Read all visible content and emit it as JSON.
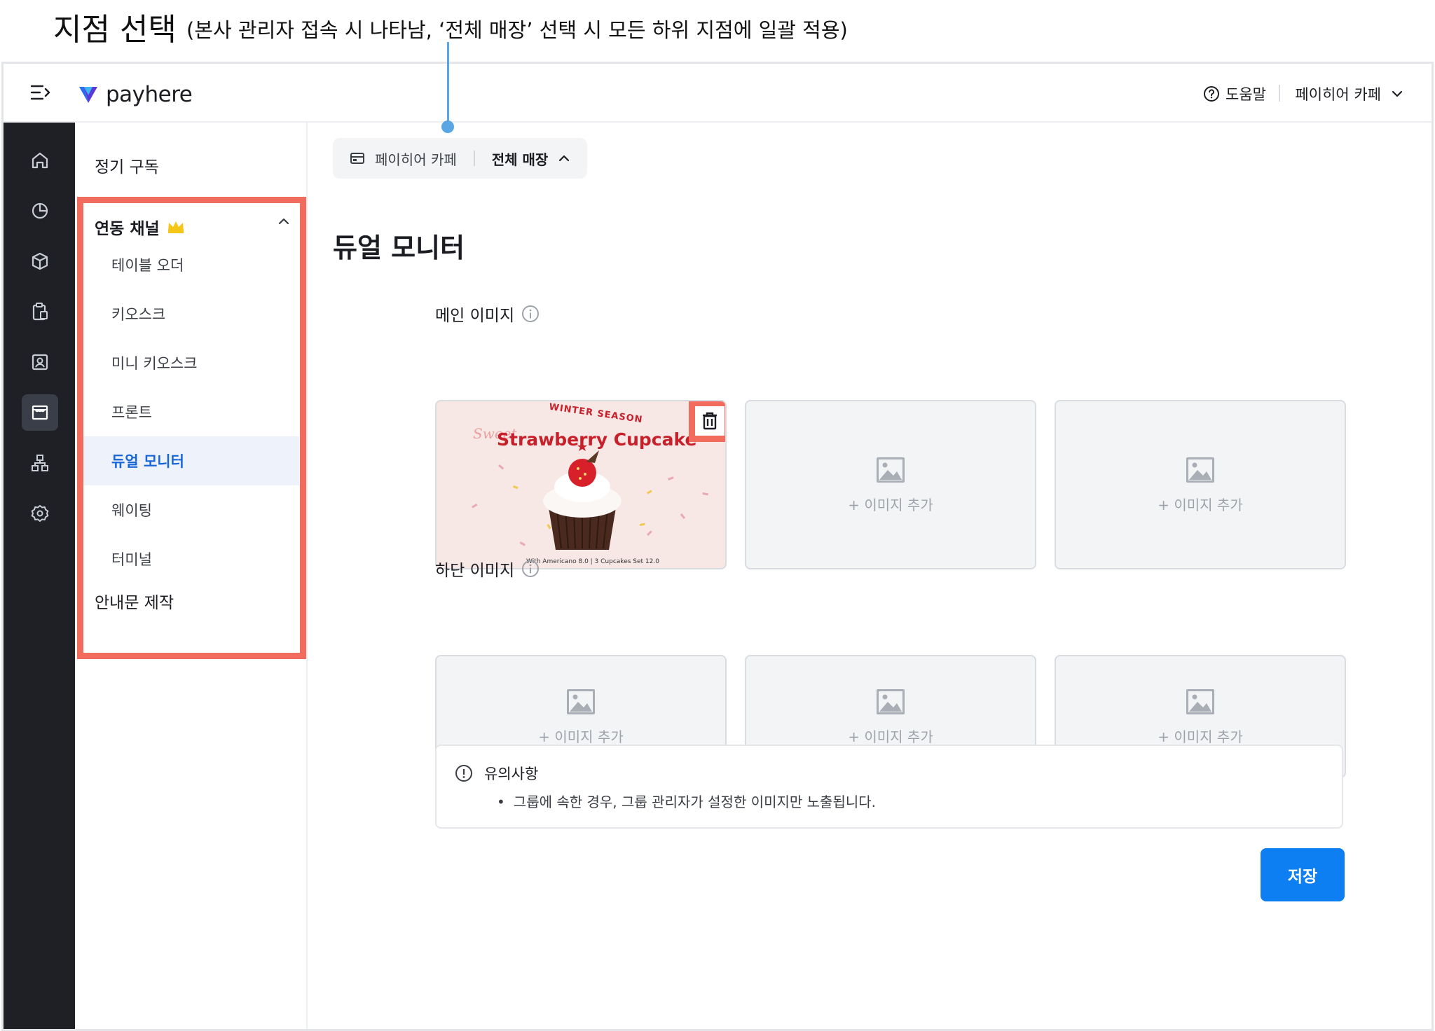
{
  "annotation": {
    "title": "지점 선택",
    "description": "(본사 관리자 접속 시 나타남, ‘전체 매장’ 선택 시 모든 하위 지점에 일괄 적용)"
  },
  "header": {
    "logo_text": "payhere",
    "help_label": "도움말",
    "store_name": "페이히어 카페"
  },
  "rail": {
    "icons": [
      "home-icon",
      "chart-icon",
      "box-icon",
      "clipboard-icon",
      "contact-icon",
      "store-icon",
      "org-icon",
      "settings-icon"
    ],
    "active": "store-icon"
  },
  "subnav": {
    "top_item": "정기 구독",
    "group_label": "연동 채널",
    "group_badge": "crown-icon",
    "items": [
      {
        "label": "테이블 오더"
      },
      {
        "label": "키오스크"
      },
      {
        "label": "미니 키오스크"
      },
      {
        "label": "프론트"
      },
      {
        "label": "듀얼 모니터",
        "active": true
      },
      {
        "label": "웨이팅"
      },
      {
        "label": "터미널"
      }
    ],
    "bottom_item": "안내문 제작"
  },
  "main": {
    "store_chip": {
      "store": "페이히어 카페",
      "scope": "전체 매장"
    },
    "title": "듀얼 모니터",
    "main_images": {
      "label": "메인 이미지",
      "promo": {
        "season": "WINTER SEASON",
        "sweet": "Sweet",
        "title": "Strawberry Cupcake",
        "footer": "With Americano 8.0  |  3 Cupcakes Set 12.0"
      },
      "add_label": "+ 이미지 추가"
    },
    "bottom_images": {
      "label": "하단 이미지",
      "add_label": "+ 이미지 추가"
    },
    "notice": {
      "title": "유의사항",
      "body": "그룹에 속한 경우, 그룹 관리자가 설정한 이미지만 노출됩니다."
    },
    "save_label": "저장"
  },
  "colors": {
    "accent_blue": "#0d7ff2",
    "highlight_red": "#f26c5e",
    "rail_bg": "#1e2026",
    "annotation_line": "#59a6e4",
    "crown": "#f5c518"
  }
}
